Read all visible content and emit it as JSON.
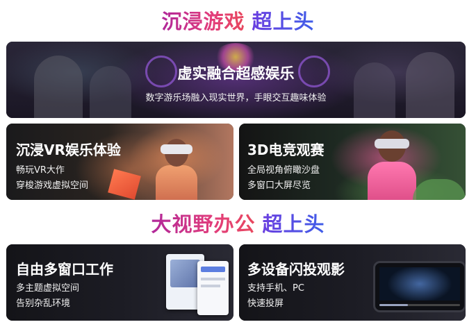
{
  "section1": {
    "part1": "沉浸游戏",
    "part2": "超上头"
  },
  "hero": {
    "title": "虚实融合超感娱乐",
    "subtitle": "数字游乐场融入现实世界，手眼交互趣味体验"
  },
  "vr": {
    "title": "沉浸VR娱乐体验",
    "line1": "畅玩VR大作",
    "line2": "穿梭游戏虚拟空间"
  },
  "esports": {
    "title": "3D电竞观赛",
    "line1": "全局视角俯瞰沙盘",
    "line2": "多窗口大屏尽览"
  },
  "section2": {
    "part1": "大视野办公",
    "part2": "超上头"
  },
  "multi": {
    "title": "自由多窗口工作",
    "line1": "多主题虚拟空间",
    "line2": "告别杂乱环境"
  },
  "cast": {
    "title": "多设备闪投观影",
    "line1": "支持手机、PC",
    "line2": "快速投屏"
  },
  "colors": {
    "heading_pink": "#d1336f",
    "heading_blue": "#4a55e6",
    "card_bg": "#141418"
  }
}
